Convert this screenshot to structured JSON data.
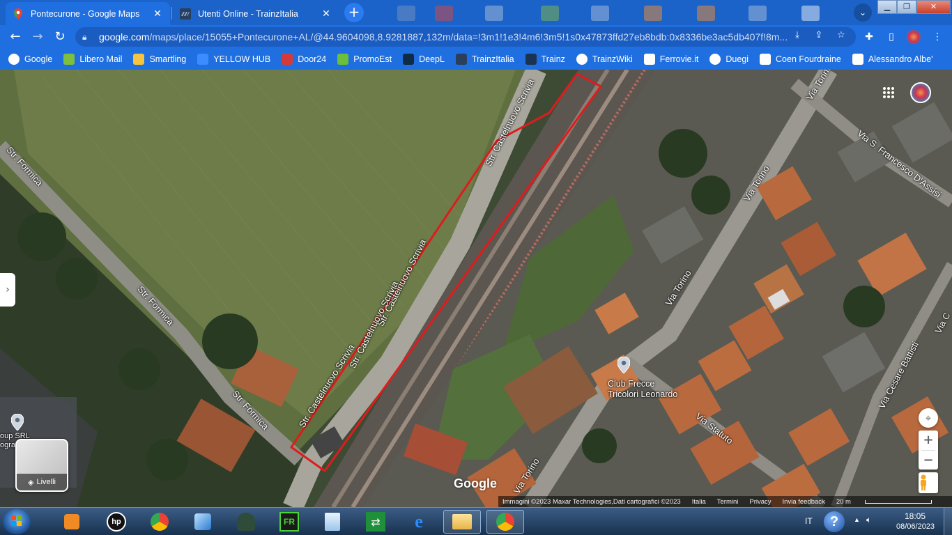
{
  "browser": {
    "tabs": [
      {
        "title": "Pontecurone - Google Maps",
        "active": true
      },
      {
        "title": "Utenti Online - TrainzItalia",
        "active": false
      }
    ],
    "new_tab_label": "+",
    "url_host": "google.com",
    "url_path": "/maps/place/15055+Pontecurone+AL/@44.9604098,8.9281887,132m/data=!3m1!1e3!4m6!3m5!1s0x47873ffd27eb8bdb:0x8336be3ac5db407f!8m...",
    "bookmarks": [
      {
        "label": "Google",
        "icon": "google-icon",
        "color": "#ffffff"
      },
      {
        "label": "Libero Mail",
        "icon": "libero-icon",
        "color": "#7fbf3f"
      },
      {
        "label": "Smartling",
        "icon": "smartling-icon",
        "color": "#f5c542"
      },
      {
        "label": "YELLOW HUB",
        "icon": "infinity-icon",
        "color": "#3a8cff"
      },
      {
        "label": "Door24",
        "icon": "door24-icon",
        "color": "#d43a3a"
      },
      {
        "label": "PromoEst",
        "icon": "promoest-icon",
        "color": "#6bbf3a"
      },
      {
        "label": "DeepL",
        "icon": "deepl-icon",
        "color": "#0f2b46"
      },
      {
        "label": "TrainzItalia",
        "icon": "trainzitalia-icon",
        "color": "#2b3f5c"
      },
      {
        "label": "Trainz",
        "icon": "trainz-icon",
        "color": "#1b3350"
      },
      {
        "label": "TrainzWiki",
        "icon": "globe-icon",
        "color": "#ffffff"
      },
      {
        "label": "Ferrovie.it",
        "icon": "ferrovie-icon",
        "color": "#ffffff"
      },
      {
        "label": "Duegi",
        "icon": "globe-icon",
        "color": "#ffffff"
      },
      {
        "label": "Coen Fourdraine",
        "icon": "flickr-icon",
        "color": "#ffffff"
      },
      {
        "label": "Alessandro Albe'",
        "icon": "flickr-icon",
        "color": "#ffffff"
      }
    ]
  },
  "map": {
    "labels": {
      "str_formica_1": "Str. Formica",
      "str_formica_2": "Str. Formica",
      "str_formica_3": "Str. Formica",
      "str_castelnuovo_1": "Str. Castelnuovo Scrivia",
      "str_castelnuovo_2": "Str. Castelnuovo Scrivia",
      "str_castelnuovo_3": "Str. Castelnuovo Scrivia",
      "str_castelnuovo_4": "Str. Castelnuovo Scrivia",
      "via_torino_1": "Via Torino",
      "via_torino_2": "Via Torino",
      "via_torino_3": "Via Torino",
      "via_torino_4": "Via Torino",
      "via_san_francesco": "Via S. Francesco D'Assisi",
      "via_statuto": "Via Statuto",
      "via_cesare_battisti": "Via Cesare Battisti",
      "via_c": "Via C"
    },
    "poi": {
      "club_line1": "Club Frecce",
      "club_line2": "Tricolori Leonardo",
      "left_poi_line1": "oup SRL",
      "left_poi_line2": "ogra"
    },
    "layers_label": "Livelli",
    "google_logo": "Google",
    "attribution": {
      "imagery": "Immagini ©2023 Maxar Technologies,Dati cartografici ©2023",
      "country": "Italia",
      "terms": "Termini",
      "privacy": "Privacy",
      "feedback": "Invia feedback",
      "scale": "20 m"
    },
    "zoom_in": "+",
    "zoom_out": "−",
    "outline_color": "#e01b1b"
  },
  "taskbar": {
    "language": "IT",
    "time": "18:05",
    "date": "08/06/2023",
    "help": "?"
  }
}
